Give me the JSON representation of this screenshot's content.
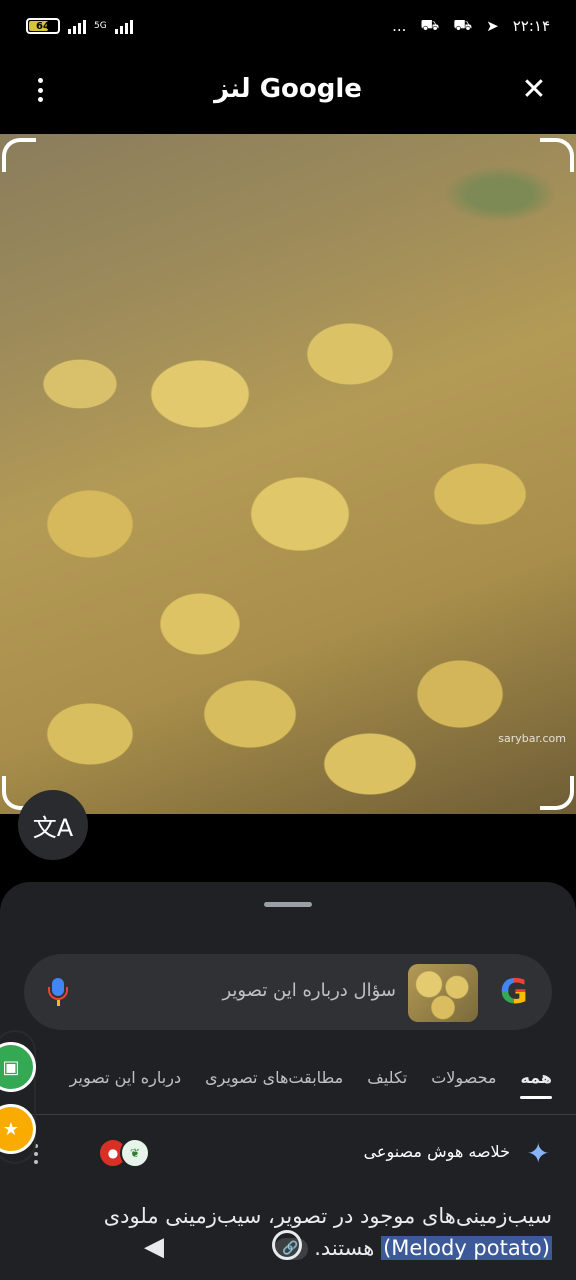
{
  "status_bar": {
    "battery": "64",
    "network": "5G",
    "time": "۲۲:۱۴",
    "dots": "..."
  },
  "header": {
    "title": "لنز Google",
    "close_icon": "close-icon",
    "menu_icon": "more-vert-icon"
  },
  "image": {
    "watermark": "sarybar.com",
    "translate_icon": "translate-icon"
  },
  "search": {
    "placeholder": "سؤال درباره این تصویر",
    "mic_icon": "mic-icon",
    "logo": "G"
  },
  "tabs": [
    {
      "label": "همه",
      "active": true
    },
    {
      "label": "محصولات",
      "active": false
    },
    {
      "label": "تکلیف",
      "active": false
    },
    {
      "label": "مطابقت‌های تصویری",
      "active": false
    },
    {
      "label": "درباره این تصویر",
      "active": false
    }
  ],
  "ai_overview": {
    "label": "خلاصه هوش مصنوعی",
    "sparkle_icon": "sparkle-icon",
    "answer_prefix": "سیب‌زمینی‌های موجود در تصویر، سیب‌زمینی ملودی",
    "answer_highlight": "(Melody potato)",
    "answer_suffix": "هستند."
  },
  "colors": {
    "background": "#000000",
    "sheet": "#202124",
    "accent_blue": "#8ab4f8",
    "highlight": "#3c5a9a"
  }
}
